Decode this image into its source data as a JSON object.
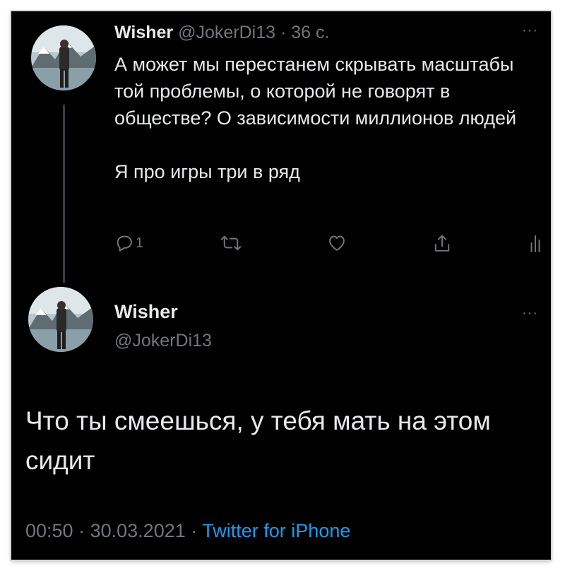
{
  "tweet1": {
    "name": "Wisher",
    "handle": "@JokerDi13",
    "separator": "·",
    "time": "36 с.",
    "more": "···",
    "text_p1": "А может мы перестанем скрывать масштабы той проблемы, о которой не говорят в обществе? О зависимости миллионов людей",
    "text_p2": "Я про игры три в ряд",
    "reply_count": "1",
    "icons": [
      "reply-icon",
      "retweet-icon",
      "like-icon",
      "share-icon",
      "analytics-icon"
    ]
  },
  "tweet2": {
    "name": "Wisher",
    "handle": "@JokerDi13",
    "more": "···",
    "text": "Что ты смеешься, у тебя мать на этом сидит",
    "time": "00:50",
    "separator1": "·",
    "date": "30.03.2021",
    "separator2": "·",
    "source": "Twitter for iPhone"
  },
  "colors": {
    "background": "#000000",
    "text": "#e7e9ea",
    "muted": "#71767b",
    "link": "#1d9bf0"
  }
}
